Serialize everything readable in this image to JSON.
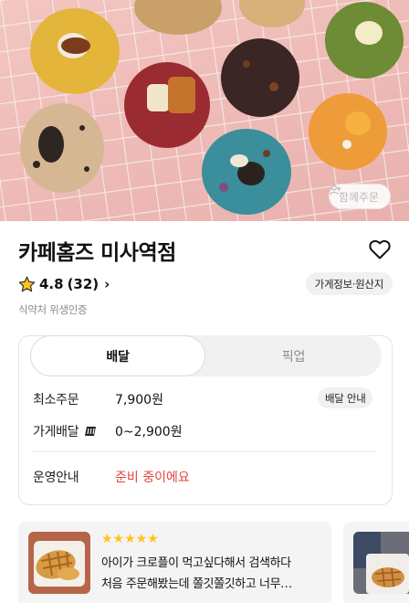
{
  "hero": {
    "together_order_label": "함께주문",
    "icon": "people-icon"
  },
  "store": {
    "name": "카페홈즈 미사역점",
    "rating": "4.8",
    "review_count": "(32)",
    "info_chip": "가게정보·원산지",
    "certification": "식약처 위생인증"
  },
  "order_tabs": {
    "delivery": "배달",
    "pickup": "픽업",
    "active": "delivery"
  },
  "delivery_info": {
    "min_order_label": "최소주문",
    "min_order_value": "7,900원",
    "fee_label": "가게배달",
    "fee_value": "0~2,900원",
    "guide_button": "배달 안내",
    "hours_label": "운영안내",
    "hours_value": "준비 중이에요"
  },
  "reviews": [
    {
      "stars": "★★★★★",
      "rating": 5,
      "line1": "아이가 크로플이 먹고싶다해서 검색하다",
      "line2": "처음 주문해봤는데 쫄깃쫄깃하고 너무…"
    }
  ],
  "colors": {
    "accent_red": "#e0463d",
    "star_yellow": "#ffc31a",
    "hero_bg": "#efbcb8"
  }
}
